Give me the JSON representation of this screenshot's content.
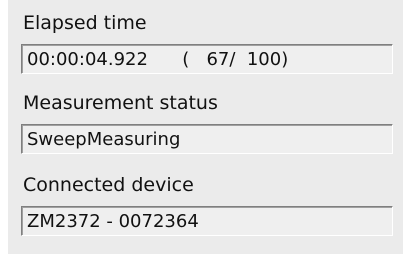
{
  "elapsed": {
    "label": "Elapsed time",
    "value": "00:00:04.922      (   67/  100)"
  },
  "status": {
    "label": "Measurement status",
    "value": "SweepMeasuring"
  },
  "device": {
    "label": "Connected device",
    "value": "ZM2372 - 0072364"
  }
}
